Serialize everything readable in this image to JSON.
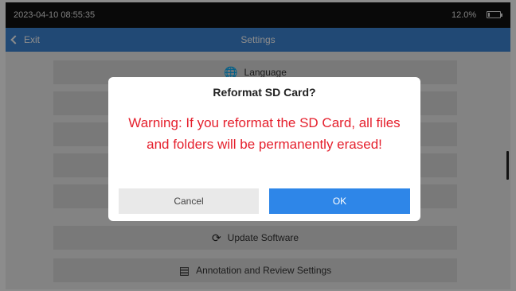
{
  "status_bar": {
    "time": "2023-04-10 08:55:35",
    "battery_text": "12.0%",
    "battery_level": 0.12,
    "battery_icon": "battery-icon"
  },
  "header": {
    "back_label": "Exit",
    "back_icon": "chevron-left-icon",
    "title": "Settings"
  },
  "settings_menu": {
    "items": [
      {
        "label": "Language",
        "icon": "globe-icon",
        "glyph": "🌐"
      },
      {
        "label": "",
        "icon": "",
        "glyph": ""
      },
      {
        "label": "",
        "icon": "",
        "glyph": ""
      },
      {
        "label": "",
        "icon": "",
        "glyph": ""
      },
      {
        "label": "",
        "icon": "",
        "glyph": ""
      },
      {
        "label": "Update Software",
        "icon": "refresh-icon",
        "glyph": "⟳"
      },
      {
        "label": "Annotation and Review Settings",
        "icon": "annotation-icon",
        "glyph": "▤"
      }
    ]
  },
  "dialog": {
    "title": "Reformat SD Card?",
    "message": "Warning: If you reformat the SD Card, all files and folders will be permanently erased!",
    "cancel_label": "Cancel",
    "ok_label": "OK"
  },
  "colors": {
    "header": "#3d86d6",
    "ok_button": "#2e86e8",
    "warning_text": "#e5202d"
  }
}
